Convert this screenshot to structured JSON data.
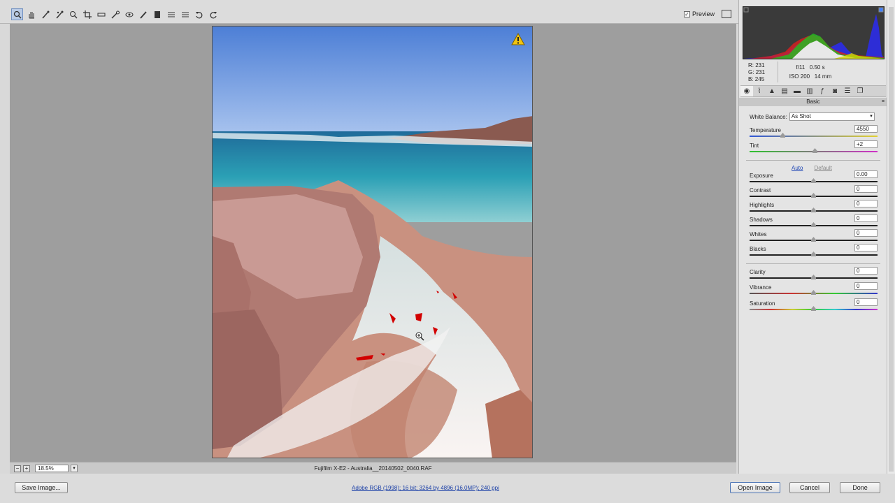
{
  "toolbar": {
    "tools": [
      "zoom-icon",
      "hand-icon",
      "white-balance-icon",
      "color-sampler-icon",
      "targeted-adjust-icon",
      "crop-icon",
      "straighten-icon",
      "spot-removal-icon",
      "red-eye-icon",
      "adjustment-brush-icon",
      "graduated-filter-icon",
      "radial-filter-icon",
      "preferences-icon",
      "rotate-left-icon",
      "rotate-right-icon"
    ],
    "preview_label": "Preview",
    "preview_checked": true
  },
  "status": {
    "zoom_value": "18.5%",
    "filename": "Fujifilm X-E2  -  Australia__20140502_0040.RAF"
  },
  "bottom": {
    "save_label": "Save Image...",
    "workflow_link": "Adobe RGB (1998); 16 bit; 3264 by 4896 (16.0MP); 240 ppi",
    "open_label": "Open Image",
    "cancel_label": "Cancel",
    "done_label": "Done"
  },
  "panel": {
    "readout": {
      "r_label": "R:",
      "r_value": "231",
      "g_label": "G:",
      "g_value": "231",
      "b_label": "B:",
      "b_value": "245"
    },
    "camera": {
      "aperture": "f/11",
      "shutter": "0.50 s",
      "iso": "ISO 200",
      "focal": "14 mm"
    },
    "tabs": [
      "basic-icon",
      "tone-curve-icon",
      "detail-icon",
      "hsl-icon",
      "split-toning-icon",
      "lens-corrections-icon",
      "effects-icon",
      "camera-calibration-icon",
      "presets-icon",
      "snapshots-icon"
    ],
    "section_title": "Basic",
    "white_balance": {
      "label": "White Balance:",
      "value": "As Shot"
    },
    "temperature": {
      "label": "Temperature",
      "value": "4550",
      "level": 0.25
    },
    "tint": {
      "label": "Tint",
      "value": "+2",
      "level": 0.51
    },
    "auto_label": "Auto",
    "default_label": "Default",
    "tone": [
      {
        "label": "Exposure",
        "value": "0.00"
      },
      {
        "label": "Contrast",
        "value": "0"
      },
      {
        "label": "Highlights",
        "value": "0"
      },
      {
        "label": "Shadows",
        "value": "0"
      },
      {
        "label": "Whites",
        "value": "0"
      },
      {
        "label": "Blacks",
        "value": "0"
      }
    ],
    "presence": [
      {
        "label": "Clarity",
        "value": "0"
      },
      {
        "label": "Vibrance",
        "value": "0"
      },
      {
        "label": "Saturation",
        "value": "0"
      }
    ]
  }
}
